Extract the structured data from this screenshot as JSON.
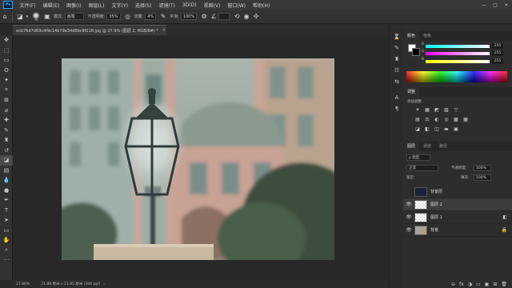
{
  "app": {
    "logo": "Ps"
  },
  "menu": [
    "文件(F)",
    "编辑(E)",
    "图像(I)",
    "图层(L)",
    "文字(Y)",
    "选择(S)",
    "滤镜(T)",
    "3D(D)",
    "视图(V)",
    "窗口(W)",
    "帮助(H)"
  ],
  "window_controls": {
    "minimize": "—",
    "maximize": "□",
    "close": "✕"
  },
  "options": {
    "brush_size": "70",
    "mode_label": "模式:",
    "mode_value": "画笔",
    "opacity_label": "不透明度:",
    "opacity_value": "35%",
    "flow_label": "流量:",
    "flow_value": "4%",
    "smoothing_label": "平滑:",
    "smoothing_value": "100%"
  },
  "tab": {
    "title": "ecb76d7d69c4f9c14b79e34d8bc9f218.jpg @ 27.9% (图层 2, RGB/8#) *",
    "close": "×"
  },
  "status": {
    "zoom": "27.86%",
    "doc_info": "31.88 厘米 x 23.85 厘米 (300 ppi)",
    "arrow": "›"
  },
  "color_panel": {
    "tabs": [
      "颜色",
      "色板"
    ],
    "channels": [
      {
        "label": "R",
        "value": "255",
        "gradient": "linear-gradient(90deg,#00ffff,#ffffff)"
      },
      {
        "label": "G",
        "value": "255",
        "gradient": "linear-gradient(90deg,#ff00ff,#ffffff)"
      },
      {
        "label": "B",
        "value": "255",
        "gradient": "linear-gradient(90deg,#ffff00,#ffffff)"
      }
    ]
  },
  "adjust_panel": {
    "tabs": [
      "调整"
    ],
    "title": "添加调整",
    "row1": [
      "☀",
      "▦",
      "◩",
      "▨",
      "▽"
    ],
    "row2": [
      "▤",
      "⚖",
      "◐",
      "◎",
      "▩",
      "▦"
    ],
    "row3": [
      "◪",
      "◧",
      "◫",
      "▬",
      "▣"
    ]
  },
  "layers_panel": {
    "tabs": [
      "图层",
      "通道",
      "路径"
    ],
    "filter_label": "ρ 类型",
    "blend_mode": "正常",
    "opacity_label": "不透明度:",
    "opacity_value": "100%",
    "lock_label": "锁定:",
    "fill_label": "填充:",
    "fill_value": "100%",
    "layers": [
      {
        "name": "背景层",
        "eye": "",
        "right": "",
        "selected": false
      },
      {
        "name": "图层 2",
        "eye": "👁",
        "right": "",
        "selected": true
      },
      {
        "name": "图层 1",
        "eye": "👁",
        "right": "◧",
        "selected": false
      },
      {
        "name": "背景",
        "eye": "👁",
        "right": "🔒",
        "selected": false
      }
    ],
    "bottom_icons": [
      "⊖",
      "fx",
      "◑",
      "▭",
      "▣",
      "⊞",
      "🗑"
    ]
  },
  "colors": {
    "accent": "#31a8ff",
    "panel": "#2d2d2d",
    "canvas_bg": "#282828"
  }
}
